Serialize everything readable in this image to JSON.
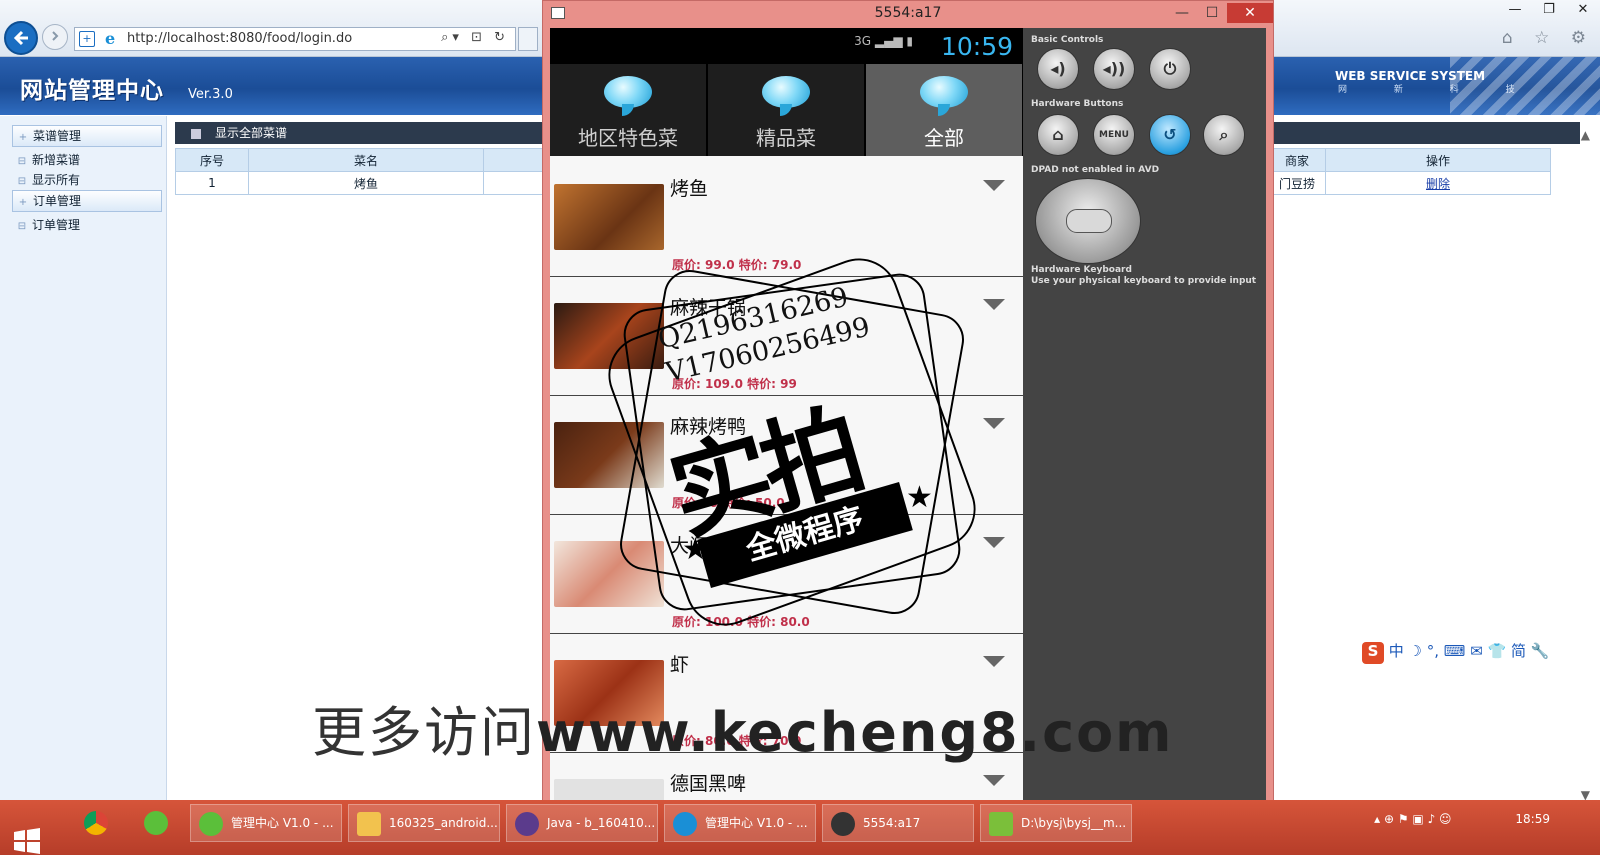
{
  "browser": {
    "address_url": "http://localhost:8080/food/login.do",
    "right_icons": "⌂ ☆ ⚙"
  },
  "admin": {
    "title": "网站管理中心",
    "version": "Ver.3.0",
    "service_title": "WEB SERVICE SYSTEM",
    "service_sub": "网 新 科 技"
  },
  "sidebar": {
    "items": [
      {
        "label": "菜谱管理",
        "mark": "+"
      },
      {
        "label": "新增菜谱",
        "mark": "⊟"
      },
      {
        "label": "显示所有",
        "mark": "⊟"
      },
      {
        "label": "订单管理",
        "mark": "+"
      },
      {
        "label": "订单管理",
        "mark": "⊟"
      }
    ]
  },
  "main": {
    "panel_title": "显示全部菜谱",
    "columns": [
      "序号",
      "菜名"
    ],
    "right_columns": [
      "商家",
      "操作"
    ],
    "rows": [
      {
        "no": "1",
        "name": "烤鱼",
        "shop": "门豆捞",
        "action": "删除"
      }
    ]
  },
  "emulator": {
    "window_title": "5554:a17",
    "status_time": "10:59",
    "status_network": "3G",
    "tabs": [
      {
        "label": "地区特色菜",
        "active": false
      },
      {
        "label": "精品菜",
        "active": false
      },
      {
        "label": "全部",
        "active": true
      }
    ],
    "foods": [
      {
        "name": "烤鱼",
        "price": "原价: 99.0  特价: 79.0",
        "color": "#8a4a1e"
      },
      {
        "name": "麻辣干锅",
        "price": "原价: 109.0  特价: 99",
        "color": "#6a2614"
      },
      {
        "name": "麻辣烤鸭",
        "price": "原价:  .0  特价: 50.0",
        "color": "#5a2c16"
      },
      {
        "name": "大闸蟹",
        "price": "原价: 100.0  特价: 80.0",
        "color": "#d7a58f"
      },
      {
        "name": "虾",
        "price": "原价: 80.0  特价: 70.0",
        "color": "#b8452a"
      },
      {
        "name": "德国黑啤",
        "price": "",
        "color": "#dddddd"
      }
    ],
    "panel": {
      "basic_controls": "Basic Controls",
      "hardware_buttons": "Hardware Buttons",
      "dpad": "DPAD not enabled in AVD",
      "keyboard": "Hardware Keyboard",
      "keyboard_note": "Use your physical keyboard to provide input",
      "menu_label": "MENU"
    }
  },
  "watermark": {
    "line1": "Q2196316269",
    "line2": "V17060256499",
    "big": "实拍",
    "banner": "全微程序",
    "bottom_prefix": "更多访问",
    "bottom_url": "www.kecheng8.com"
  },
  "ime": {
    "label": "S",
    "items": "中 ☽ °, ⌨ ✉ 👕 简 🔧"
  },
  "taskbar": {
    "items": [
      {
        "label": "管理中心 V1.0 - ..."
      },
      {
        "label": "160325_android..."
      },
      {
        "label": "Java - b_160410..."
      },
      {
        "label": "管理中心 V1.0 - ..."
      },
      {
        "label": "5554:a17"
      },
      {
        "label": "D:\\bysj\\bysj__m..."
      }
    ],
    "clock": "18:59"
  }
}
